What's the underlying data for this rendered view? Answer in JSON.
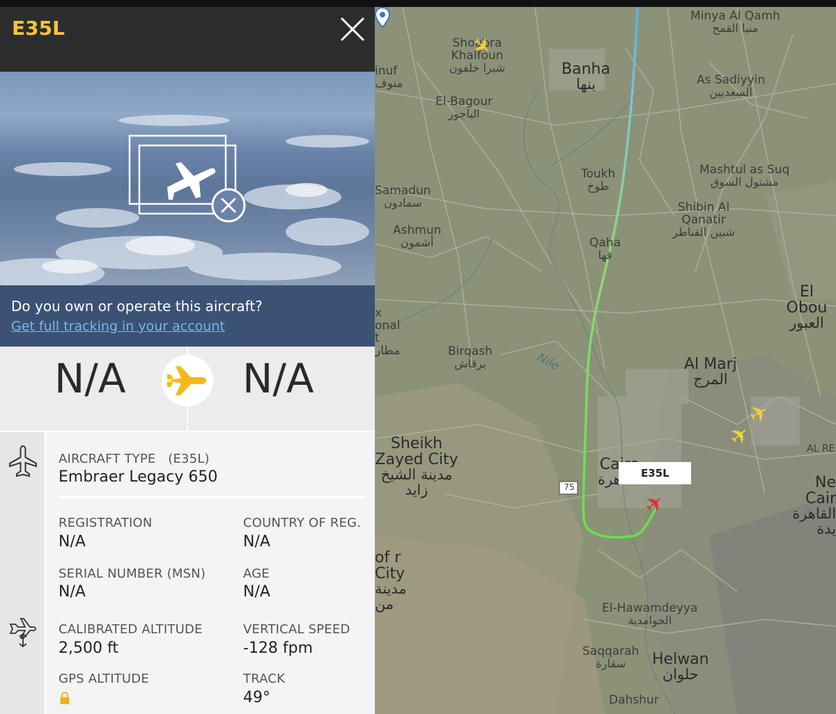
{
  "panel": {
    "callsign": "E35L",
    "promo_question": "Do you own or operate this aircraft?",
    "promo_link": "Get full tracking in your account",
    "origin": "N/A",
    "destination": "N/A"
  },
  "details": {
    "aircraft_type_label": "AIRCRAFT TYPE",
    "aircraft_type_code": "(E35L)",
    "aircraft_type_value": "Embraer Legacy 650",
    "registration_label": "REGISTRATION",
    "registration_value": "N/A",
    "country_label": "COUNTRY OF REG.",
    "country_value": "N/A",
    "serial_label": "SERIAL NUMBER (MSN)",
    "serial_value": "N/A",
    "age_label": "AGE",
    "age_value": "N/A",
    "cal_alt_label": "CALIBRATED ALTITUDE",
    "cal_alt_value": "2,500 ft",
    "vspeed_label": "VERTICAL SPEED",
    "vspeed_value": "-128 fpm",
    "gps_alt_label": "GPS ALTITUDE",
    "track_label": "TRACK",
    "track_value": "49°"
  },
  "map": {
    "flight_label": "E35L",
    "road_shield": "75",
    "labels": {
      "minya_en": "Minya Al Qamh",
      "minya_ar": "منيا القمح",
      "banha_en": "Banha",
      "banha_ar": "بنها",
      "shoubra_en": "Shoubra Khalfoun",
      "shoubra_ar": "شبرا خلفون",
      "sadiyyin_en": "As Sadiyyin",
      "sadiyyin_ar": "السعديين",
      "bagour_en": "El-Bagour",
      "bagour_ar": "الباجور",
      "toukh_en": "Toukh",
      "toukh_ar": "طوخ",
      "mashtul_en": "Mashtul as Suq",
      "mashtul_ar": "مشتول السوق",
      "shibin_en": "Shibin Al Qanatir",
      "shibin_ar": "شبين القناطر",
      "samadun_en": "Samadun",
      "samadun_ar": "سمادون",
      "ashmun_en": "Ashmun",
      "ashmun_ar": "أشمون",
      "qaha_en": "Qaha",
      "qaha_ar": "قها",
      "obour_en": "El Obou",
      "obour_ar": "العبور",
      "birqash_en": "Birqash",
      "birqash_ar": "برقاش",
      "nile": "Nile",
      "almarj_en": "Al Marj",
      "almarj_ar": "المرج",
      "sheikh_en": "Sheikh Zayed City",
      "sheikh_ar": "مدينة الشيخ زايد",
      "cairo_en": "Cairo",
      "cairo_ar": "القاهرة",
      "newcairo_en": "Ne Cair",
      "newcairo_ar": "القاهرة يدة",
      "alre": "AL RE",
      "october_en": "of r City",
      "october_ar": "مدينة من",
      "hawamdeyya_en": "El-Hawamdeyya",
      "hawamdeyya_ar": "الحوامدية",
      "saqqarah_en": "Saqqarah",
      "saqqarah_ar": "سقارة",
      "helwan_en": "Helwan",
      "helwan_ar": "حلوان",
      "dahshur_en": "Dahshur",
      "partial_inuf": "inuf منوف",
      "partial_left": "x onal t مطار"
    }
  },
  "colors": {
    "callsign": "#f5c537",
    "header_bg": "#2d2d2d",
    "promo_bg": "#3b5274",
    "link": "#7cb5e8",
    "track_start": "#66e04a",
    "track_end": "#7fb9e6",
    "plane_selected": "#d9332b",
    "plane_other": "#f3d13a"
  }
}
